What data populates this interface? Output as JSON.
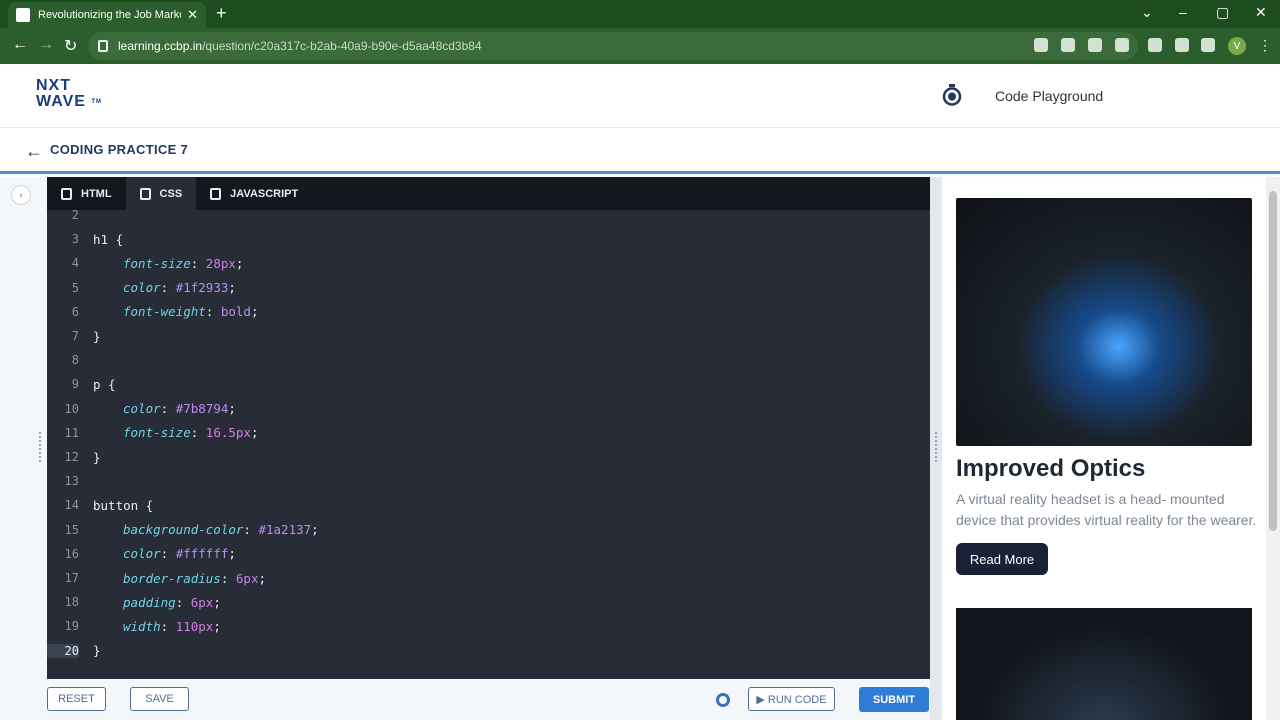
{
  "browser": {
    "tab_title": "Revolutionizing the Job Market |",
    "new_tab": "+",
    "tab_close": "✕",
    "url_host": "learning.ccbp.in",
    "url_path": "/question/c20a317c-b2ab-40a9-b90e-d5aa48cd3b84",
    "avatar_letter": "V"
  },
  "header": {
    "logo_line1": "NXT",
    "logo_line2": "WAVE",
    "logo_tm": "TM",
    "code_playground": "Code Playground"
  },
  "subheader": {
    "back_icon": "←",
    "title": "CODING PRACTICE 7"
  },
  "editor": {
    "tabs": [
      {
        "label": "HTML"
      },
      {
        "label": "CSS"
      },
      {
        "label": "JAVASCRIPT"
      }
    ],
    "active_tab": "CSS",
    "lines": [
      {
        "n": "2",
        "text": ""
      },
      {
        "n": "3",
        "sel": "h1 {"
      },
      {
        "n": "4",
        "prop": "font-size",
        "val": "28px"
      },
      {
        "n": "5",
        "prop": "color",
        "val": "#1f2933"
      },
      {
        "n": "6",
        "prop": "font-weight",
        "val": "bold"
      },
      {
        "n": "7",
        "sel": "}"
      },
      {
        "n": "8",
        "text": ""
      },
      {
        "n": "9",
        "sel": "p {"
      },
      {
        "n": "10",
        "prop": "color",
        "val": "#7b8794"
      },
      {
        "n": "11",
        "prop": "font-size",
        "val": "16.5px"
      },
      {
        "n": "12",
        "sel": "}"
      },
      {
        "n": "13",
        "text": ""
      },
      {
        "n": "14",
        "sel": "button {"
      },
      {
        "n": "15",
        "prop": "background-color",
        "val": "#1a2137"
      },
      {
        "n": "16",
        "prop": "color",
        "val": "#ffffff"
      },
      {
        "n": "17",
        "prop": "border-radius",
        "val": "6px"
      },
      {
        "n": "18",
        "prop": "padding",
        "val": "6px"
      },
      {
        "n": "19",
        "prop": "width",
        "val": "110px"
      },
      {
        "n": "20",
        "sel": "}"
      }
    ]
  },
  "buttons": {
    "reset": "RESET",
    "save": "SAVE",
    "run_code": "▶ RUN CODE",
    "submit": "SUBMIT"
  },
  "preview": {
    "heading": "Improved Optics",
    "paragraph": "A virtual reality headset is a head- mounted device that provides virtual reality for the wearer.",
    "button": "Read More"
  }
}
